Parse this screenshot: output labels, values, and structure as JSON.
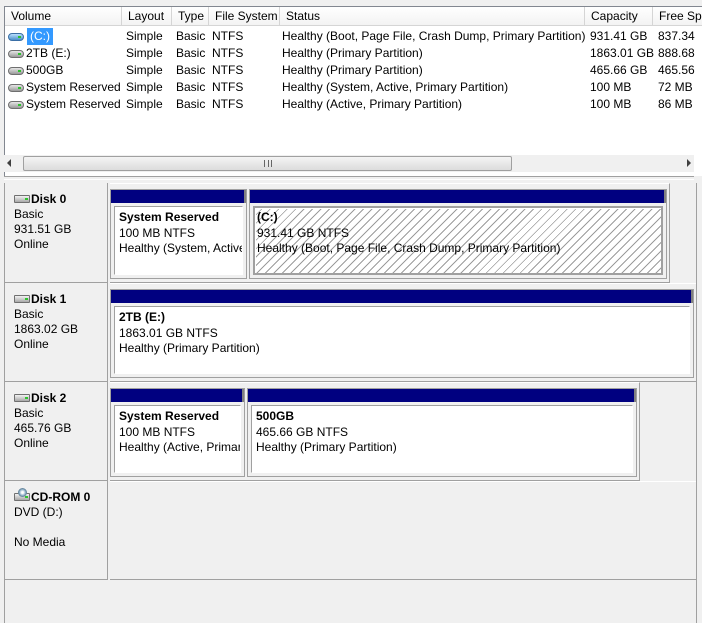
{
  "volume_list": {
    "columns": [
      "Volume",
      "Layout",
      "Type",
      "File System",
      "Status",
      "Capacity",
      "Free Sp"
    ],
    "rows": [
      {
        "volume": "(C:)",
        "layout": "Simple",
        "type": "Basic",
        "fs": "NTFS",
        "status": "Healthy (Boot, Page File, Crash Dump, Primary Partition)",
        "capacity": "931.41 GB",
        "free": "837.34",
        "icon": "volume-blue-icon",
        "selected": true
      },
      {
        "volume": "2TB (E:)",
        "layout": "Simple",
        "type": "Basic",
        "fs": "NTFS",
        "status": "Healthy (Primary Partition)",
        "capacity": "1863.01 GB",
        "free": "888.68",
        "icon": "volume-icon",
        "selected": false
      },
      {
        "volume": "500GB",
        "layout": "Simple",
        "type": "Basic",
        "fs": "NTFS",
        "status": "Healthy (Primary Partition)",
        "capacity": "465.66 GB",
        "free": "465.56",
        "icon": "volume-icon",
        "selected": false
      },
      {
        "volume": "System Reserved",
        "layout": "Simple",
        "type": "Basic",
        "fs": "NTFS",
        "status": "Healthy (System, Active, Primary Partition)",
        "capacity": "100 MB",
        "free": "72 MB",
        "icon": "volume-icon",
        "selected": false
      },
      {
        "volume": "System Reserved",
        "layout": "Simple",
        "type": "Basic",
        "fs": "NTFS",
        "status": "Healthy (Active, Primary Partition)",
        "capacity": "100 MB",
        "free": "86 MB",
        "icon": "volume-icon",
        "selected": false
      }
    ],
    "scrollbar_grip": "III"
  },
  "disks": [
    {
      "name": "Disk 0",
      "type": "Basic",
      "size": "931.51 GB",
      "status": "Online",
      "icon": "disk-icon",
      "partitions": [
        {
          "name": "System Reserved",
          "size": "100 MB NTFS",
          "status": "Healthy (System, Active, Primary Partition)",
          "selected": false
        },
        {
          "name": " (C:)",
          "size": "931.41 GB NTFS",
          "status": "Healthy (Boot, Page File, Crash Dump, Primary Partition)",
          "selected": true
        }
      ]
    },
    {
      "name": "Disk 1",
      "type": "Basic",
      "size": "1863.02 GB",
      "status": "Online",
      "icon": "disk-icon",
      "partitions": [
        {
          "name": "2TB  (E:)",
          "size": "1863.01 GB NTFS",
          "status": "Healthy (Primary Partition)",
          "selected": false
        }
      ]
    },
    {
      "name": "Disk 2",
      "type": "Basic",
      "size": "465.76 GB",
      "status": "Online",
      "icon": "disk-icon",
      "partitions": [
        {
          "name": "System Reserved",
          "size": "100 MB NTFS",
          "status": "Healthy (Active, Primary Partition)",
          "selected": false
        },
        {
          "name": "500GB",
          "size": "465.66 GB NTFS",
          "status": "Healthy (Primary Partition)",
          "selected": false
        }
      ]
    },
    {
      "name": "CD-ROM 0",
      "type": "DVD (D:)",
      "size": "",
      "status": "No Media",
      "icon": "cdrom-icon",
      "partitions": []
    }
  ],
  "colors": {
    "partition_bar": "#000080",
    "selection": "#3399ff",
    "background": "#f0f0f0"
  }
}
